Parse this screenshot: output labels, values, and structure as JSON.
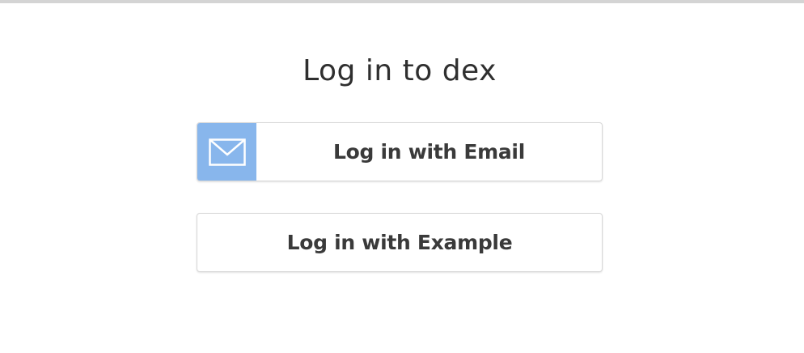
{
  "page": {
    "title": "Log in to dex"
  },
  "connectors": [
    {
      "label": "Log in with Email",
      "icon": "email-envelope-icon",
      "icon_bg": "#88b6ec"
    },
    {
      "label": "Log in with Example",
      "icon": null
    }
  ],
  "colors": {
    "text": "#2f2f2f",
    "button_text": "#3a3a3a",
    "border": "#d8d8d8",
    "top_bar": "#d4d4d4"
  }
}
